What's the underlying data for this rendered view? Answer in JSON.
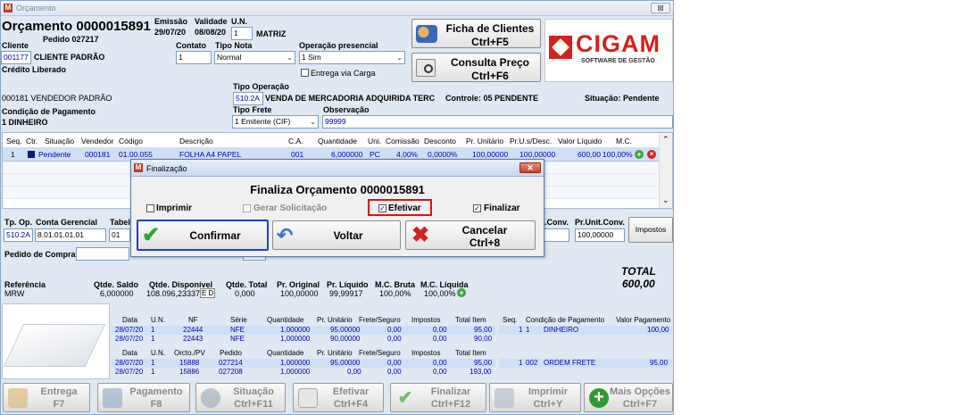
{
  "window": {
    "title": "Orçamento",
    "close": "⊠"
  },
  "header": {
    "title": "Orçamento 0000015891",
    "pedido": "Pedido 027217",
    "emissao_label": "Emissão",
    "emissao_value": "29/07/20",
    "validade_label": "Validade",
    "validade_value": "08/08/20",
    "un_label": "U.N.",
    "un_value": "1",
    "un_name": "MATRIZ",
    "cliente_label": "Cliente",
    "cliente_code": "001177",
    "cliente_name": "CLIENTE PADRÃO",
    "credito": "Crédito Liberado",
    "contato_label": "Contato",
    "contato_value": "1",
    "tiponota_label": "Tipo Nota",
    "tiponota_value": "Normal",
    "operacao_label": "Operação presencial",
    "operacao_value": "1 Sim",
    "entrega_label": "Entrega via Carga",
    "vendedor": "000181  VENDEDOR PADRÃO",
    "tipooperacao_label": "Tipo Operação",
    "tipooperacao_code": "510.2A",
    "tipooperacao_desc": "VENDA DE MERCADORIA ADQUIRIDA TERC",
    "controle": "Controle:  05   PENDENTE",
    "situacao": "Situação:  Pendente",
    "condicao_label": "Condição de Pagamento",
    "condicao_value": "1     DINHEIRO",
    "tipofrete_label": "Tipo Frete",
    "tipofrete_value": "1 Emitente (CIF)",
    "observacao_label": "Observação",
    "observacao_value": "99999"
  },
  "buttons": {
    "ficha_l1": "Ficha de Clientes",
    "ficha_l2": "Ctrl+F5",
    "consulta_l1": "Consulta Preço",
    "consulta_l2": "Ctrl+F6"
  },
  "logo": {
    "brand": "CIGAM",
    "tagline": "SOFTWARE DE GESTÃO"
  },
  "grid": {
    "headers": [
      "Seq.",
      "Ctr.",
      "Situação",
      "Vendedor",
      "Código",
      "Descrição",
      "C.A.",
      "Quantidade",
      "Uni.",
      "Comissão",
      "Desconto",
      "Pr. Unitário",
      "Pr.U.s/Desc.",
      "Valor Líquido",
      "M.C."
    ],
    "row": [
      "1",
      "",
      "Pendente",
      "000181",
      "01.00.055",
      "FOLHA A4 PAPEL",
      "001",
      "6,000000",
      "PC",
      "4,00%",
      "0,0000%",
      "100,00000",
      "100,00000",
      "600,00",
      "100,00%"
    ]
  },
  "lower": {
    "tpop_label": "Tp. Op.",
    "tpop_value": "510.2A",
    "conta_label": "Conta Gerencial",
    "conta_value": "8.01.01.01.01",
    "tabel_label": "Tabel",
    "tabel_value": "01",
    "conv_label": ".Conv.",
    "prunit_label": "Pr.Unit.Conv.",
    "prunit_value": "100,00000",
    "impostos": "Impostos",
    "pedidocompra_label": "Pedido de Compra",
    "total_label": "TOTAL",
    "total_value": "600,00",
    "referencia_label": "Referência",
    "referencia_value": "MRW",
    "qtdesaldo_label": "Qtde. Saldo",
    "qtdesaldo_value": "6,000000",
    "qtdedisp_label": "Qtde. Disponível",
    "qtdedisp_value": "108.096,233375",
    "ed": "E D",
    "qtdetotal_label": "Qtde. Total",
    "qtdetotal_value": "0,000",
    "prorig_label": "Pr. Original",
    "prorig_value": "100,00000",
    "prliq_label": "Pr. Líquido",
    "prliq_value": "99,99917",
    "mcbruta_label": "M.C. Bruta",
    "mcbruta_value": "100,00%",
    "mcliq_label": "M.C. Líquida",
    "mcliq_value": "100,00%"
  },
  "nf_table": {
    "headers": [
      "Data",
      "U.N.",
      "NF",
      "Série",
      "Quantidade",
      "Pr. Unitário",
      "Frete/Seguro",
      "Impostos",
      "Total Item"
    ],
    "rows": [
      [
        "28/07/20",
        "1",
        "22444",
        "NFE",
        "1,000000",
        "95,00000",
        "0,00",
        "0,00",
        "95,00"
      ],
      [
        "28/07/20",
        "1",
        "22443",
        "NFE",
        "1,000000",
        "90,00000",
        "0,00",
        "0,00",
        "90,00"
      ]
    ]
  },
  "pag_table": {
    "headers": [
      "Seq.",
      "Condição de Pagamento",
      "Valor Pagamento"
    ],
    "rows": [
      [
        "1",
        "1",
        "DINHEIRO",
        "100,00"
      ]
    ]
  },
  "orc_table": {
    "headers": [
      "Data",
      "U.N.",
      "Orcto./PV",
      "Pedido",
      "Quantidade",
      "Pr. Unitário",
      "Frete/Seguro",
      "Impostos",
      "Total Item"
    ],
    "rows": [
      [
        "28/07/20",
        "1",
        "15888",
        "027214",
        "1,000000",
        "95,00000",
        "0,00",
        "0,00",
        "95,00"
      ],
      [
        "28/07/20",
        "1",
        "15886",
        "027208",
        "1,000000",
        "0,00",
        "0,00",
        "0,00",
        "193,00"
      ]
    ]
  },
  "pag2_table": {
    "rows": [
      [
        "1",
        "002",
        "ORDEM FRETE",
        "95,00"
      ]
    ]
  },
  "dialog": {
    "title": "Finalização",
    "heading": "Finaliza Orçamento 0000015891",
    "imprimir": "Imprimir",
    "gerar": "Gerar Solicitação",
    "efetivar": "Efetivar",
    "finalizar": "Finalizar",
    "confirmar": "Confirmar",
    "voltar": "Voltar",
    "cancelar_l1": "Cancelar",
    "cancelar_l2": "Ctrl+8"
  },
  "toolbar": [
    {
      "l1": "Entrega",
      "l2": "F7"
    },
    {
      "l1": "Pagamento",
      "l2": "F8"
    },
    {
      "l1": "Situação",
      "l2": "Ctrl+F11"
    },
    {
      "l1": "Efetivar",
      "l2": "Ctrl+F4"
    },
    {
      "l1": "Finalizar",
      "l2": "Ctrl+F12"
    },
    {
      "l1": "Imprimir",
      "l2": "Ctrl+Y"
    },
    {
      "l1": "Mais Opções",
      "l2": "Ctrl+F7"
    }
  ],
  "colors": {
    "accent": "#0000a8",
    "selection": "#cfe0f6",
    "brand_red": "#d6201e",
    "highlight_red": "#e01010",
    "focus_blue": "#1c3fd6"
  }
}
